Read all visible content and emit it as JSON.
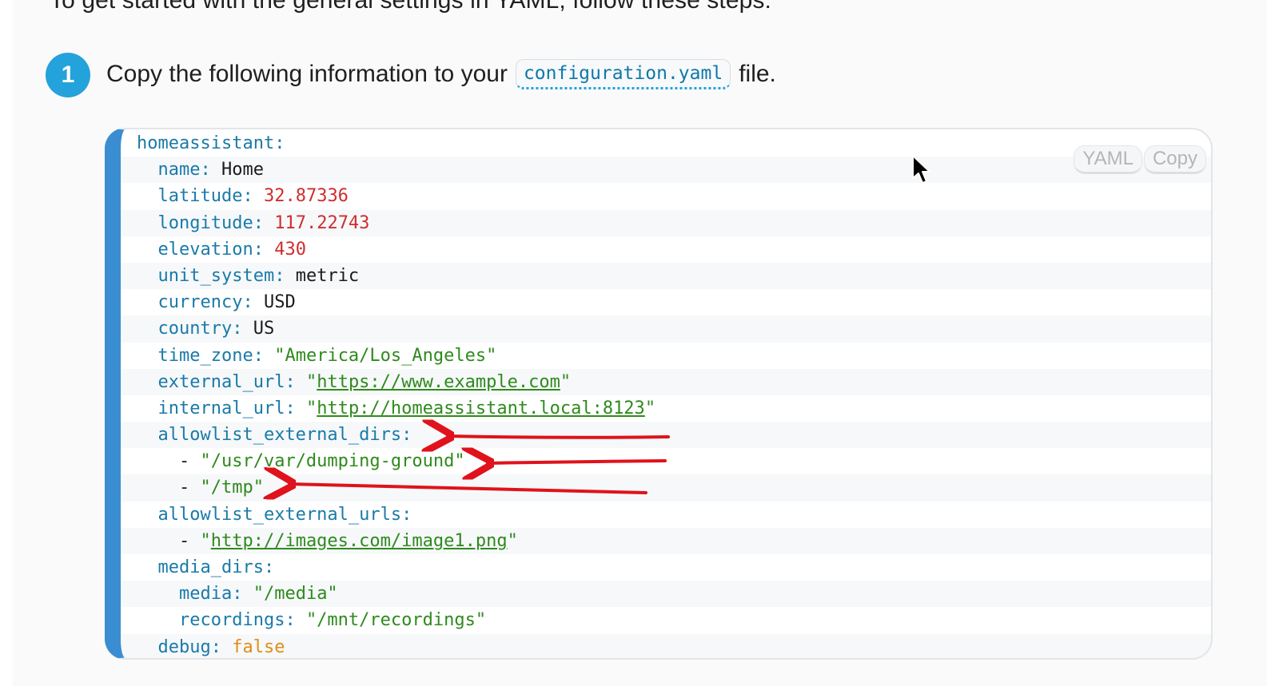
{
  "intro_text": "To get started with the general settings in YAML, follow these steps:",
  "step": {
    "number": "1",
    "text_before": "Copy the following information to your",
    "code": "configuration.yaml",
    "text_after": "file."
  },
  "code_block": {
    "language_label": "YAML",
    "copy_label": "Copy",
    "lines": [
      [
        {
          "t": "key",
          "v": "homeassistant"
        },
        {
          "t": "punct",
          "v": ":"
        }
      ],
      [
        {
          "t": "plain",
          "v": "  "
        },
        {
          "t": "key",
          "v": "name"
        },
        {
          "t": "punct",
          "v": ": "
        },
        {
          "t": "plain",
          "v": "Home"
        }
      ],
      [
        {
          "t": "plain",
          "v": "  "
        },
        {
          "t": "key",
          "v": "latitude"
        },
        {
          "t": "punct",
          "v": ": "
        },
        {
          "t": "num",
          "v": "32.87336"
        }
      ],
      [
        {
          "t": "plain",
          "v": "  "
        },
        {
          "t": "key",
          "v": "longitude"
        },
        {
          "t": "punct",
          "v": ": "
        },
        {
          "t": "num",
          "v": "117.22743"
        }
      ],
      [
        {
          "t": "plain",
          "v": "  "
        },
        {
          "t": "key",
          "v": "elevation"
        },
        {
          "t": "punct",
          "v": ": "
        },
        {
          "t": "num",
          "v": "430"
        }
      ],
      [
        {
          "t": "plain",
          "v": "  "
        },
        {
          "t": "key",
          "v": "unit_system"
        },
        {
          "t": "punct",
          "v": ": "
        },
        {
          "t": "plain",
          "v": "metric"
        }
      ],
      [
        {
          "t": "plain",
          "v": "  "
        },
        {
          "t": "key",
          "v": "currency"
        },
        {
          "t": "punct",
          "v": ": "
        },
        {
          "t": "plain",
          "v": "USD"
        }
      ],
      [
        {
          "t": "plain",
          "v": "  "
        },
        {
          "t": "key",
          "v": "country"
        },
        {
          "t": "punct",
          "v": ": "
        },
        {
          "t": "plain",
          "v": "US"
        }
      ],
      [
        {
          "t": "plain",
          "v": "  "
        },
        {
          "t": "key",
          "v": "time_zone"
        },
        {
          "t": "punct",
          "v": ": "
        },
        {
          "t": "str",
          "v": "\"America/Los_Angeles\""
        }
      ],
      [
        {
          "t": "plain",
          "v": "  "
        },
        {
          "t": "key",
          "v": "external_url"
        },
        {
          "t": "punct",
          "v": ": "
        },
        {
          "t": "str",
          "v": "\""
        },
        {
          "t": "link",
          "v": "https://www.example.com"
        },
        {
          "t": "str",
          "v": "\""
        }
      ],
      [
        {
          "t": "plain",
          "v": "  "
        },
        {
          "t": "key",
          "v": "internal_url"
        },
        {
          "t": "punct",
          "v": ": "
        },
        {
          "t": "str",
          "v": "\""
        },
        {
          "t": "link",
          "v": "http://homeassistant.local:8123"
        },
        {
          "t": "str",
          "v": "\""
        }
      ],
      [
        {
          "t": "plain",
          "v": "  "
        },
        {
          "t": "key",
          "v": "allowlist_external_dirs"
        },
        {
          "t": "punct",
          "v": ":"
        }
      ],
      [
        {
          "t": "plain",
          "v": "    - "
        },
        {
          "t": "str",
          "v": "\"/usr/var/dumping-ground\""
        }
      ],
      [
        {
          "t": "plain",
          "v": "    - "
        },
        {
          "t": "str",
          "v": "\"/tmp\""
        }
      ],
      [
        {
          "t": "plain",
          "v": "  "
        },
        {
          "t": "key",
          "v": "allowlist_external_urls"
        },
        {
          "t": "punct",
          "v": ":"
        }
      ],
      [
        {
          "t": "plain",
          "v": "    - "
        },
        {
          "t": "str",
          "v": "\""
        },
        {
          "t": "link",
          "v": "http://images.com/image1.png"
        },
        {
          "t": "str",
          "v": "\""
        }
      ],
      [
        {
          "t": "plain",
          "v": "  "
        },
        {
          "t": "key",
          "v": "media_dirs"
        },
        {
          "t": "punct",
          "v": ":"
        }
      ],
      [
        {
          "t": "plain",
          "v": "    "
        },
        {
          "t": "key",
          "v": "media"
        },
        {
          "t": "punct",
          "v": ": "
        },
        {
          "t": "str",
          "v": "\"/media\""
        }
      ],
      [
        {
          "t": "plain",
          "v": "    "
        },
        {
          "t": "key",
          "v": "recordings"
        },
        {
          "t": "punct",
          "v": ": "
        },
        {
          "t": "str",
          "v": "\"/mnt/recordings\""
        }
      ],
      [
        {
          "t": "plain",
          "v": "  "
        },
        {
          "t": "key",
          "v": "debug"
        },
        {
          "t": "punct",
          "v": ": "
        },
        {
          "t": "bool",
          "v": "false"
        }
      ]
    ]
  },
  "colors": {
    "accent": "#24a2dc",
    "code_border": "#3a8dd0",
    "key": "#1a7aa8",
    "number": "#cf2e2e",
    "string": "#2f8a1d",
    "boolean": "#e08e16",
    "annotation_arrow": "#e0121b"
  },
  "icons": {
    "cursor": "mouse-pointer-icon",
    "annotation": "red-arrow-icon"
  }
}
